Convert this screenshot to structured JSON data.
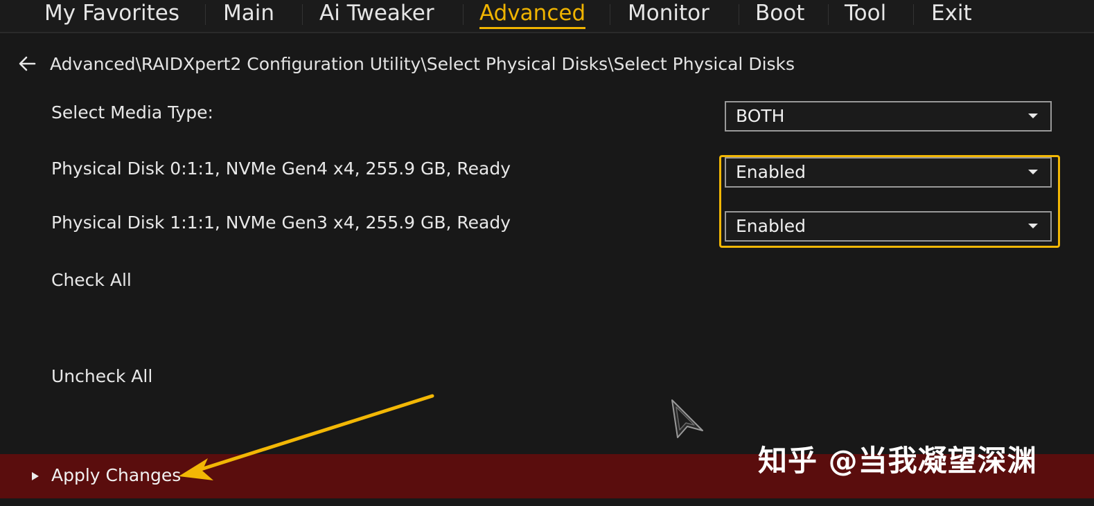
{
  "menu": {
    "tabs": [
      {
        "label": "My Favorites"
      },
      {
        "label": "Main"
      },
      {
        "label": "Ai Tweaker"
      },
      {
        "label": "Advanced"
      },
      {
        "label": "Monitor"
      },
      {
        "label": "Boot"
      },
      {
        "label": "Tool"
      },
      {
        "label": "Exit"
      }
    ],
    "active": "Advanced"
  },
  "breadcrumb": {
    "path": "Advanced\\RAIDXpert2 Configuration Utility\\Select Physical Disks\\Select Physical Disks"
  },
  "settings": {
    "media_type": {
      "label": "Select Media Type:",
      "value": "BOTH"
    },
    "disk0": {
      "label": "Physical Disk 0:1:1, NVMe Gen4 x4, 255.9 GB, Ready",
      "value": "Enabled"
    },
    "disk1": {
      "label": "Physical Disk 1:1:1, NVMe Gen3 x4, 255.9 GB, Ready",
      "value": "Enabled"
    }
  },
  "actions": {
    "check_all": "Check All",
    "uncheck_all": "Uncheck All",
    "apply_changes": "Apply Changes"
  },
  "watermark": "知乎 @当我凝望深渊",
  "colors": {
    "accent": "#f0b400",
    "highlight_box": "#f2b705",
    "bottom_bar": "#5a0d0d",
    "background": "#181818"
  },
  "icons": {
    "back": "left-arrow-icon",
    "dropdown": "chevron-down-icon",
    "apply": "chevron-right-icon",
    "cursor": "mouse-pointer-icon"
  }
}
